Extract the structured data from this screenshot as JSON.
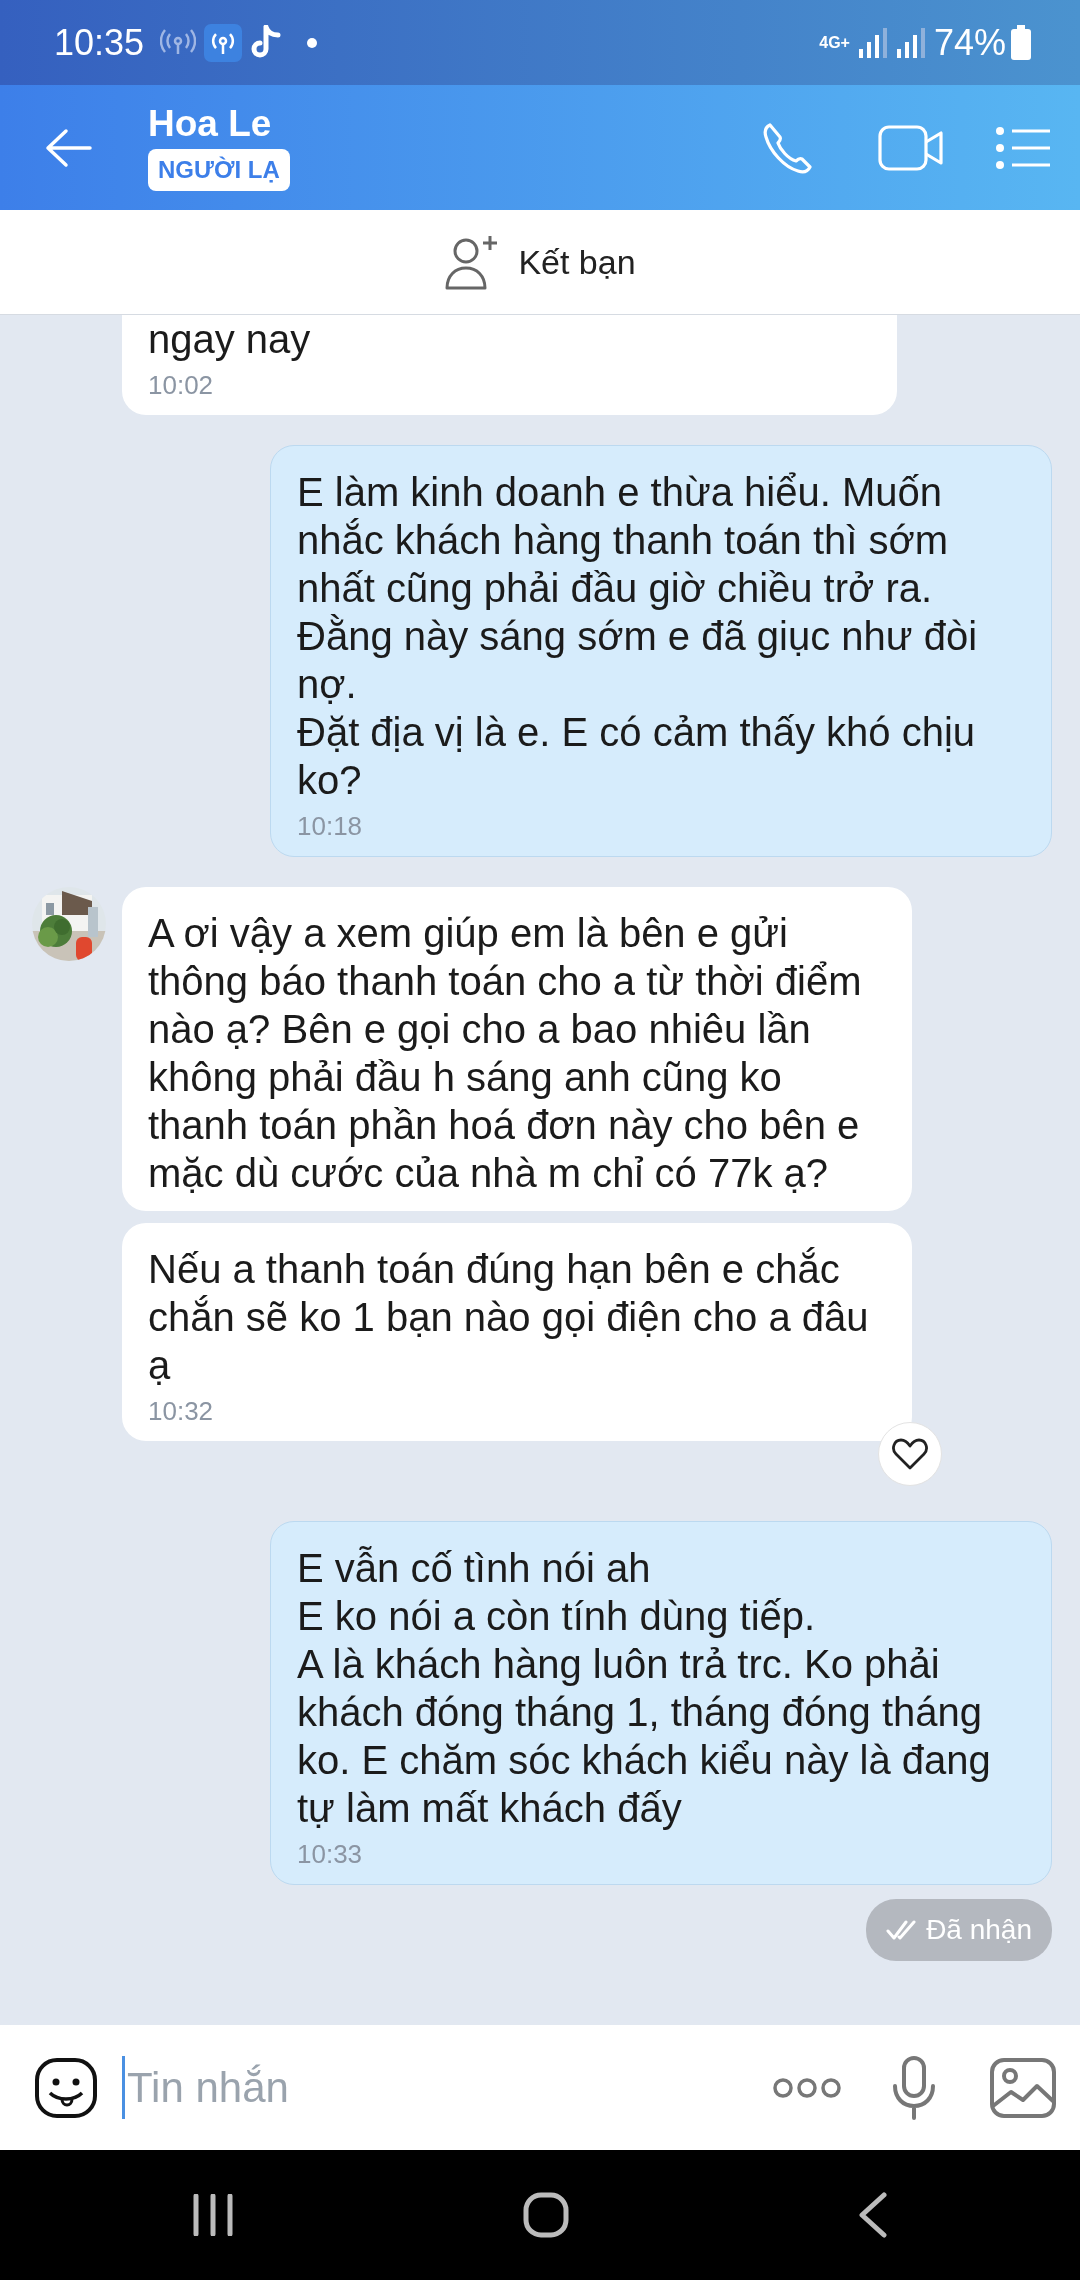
{
  "status_bar": {
    "time": "10:35",
    "network": "4G+",
    "battery": "74%"
  },
  "header": {
    "name": "Hoa Le",
    "badge": "NGƯỜI LẠ"
  },
  "add_friend": {
    "label": "Kết bạn"
  },
  "messages": [
    {
      "kind": "received",
      "avatar": false,
      "text": "ngay nay",
      "time": "10:02",
      "reaction_button": false
    },
    {
      "kind": "sent",
      "avatar": false,
      "text": "E làm kinh doanh e thừa hiểu. Muốn nhắc khách hàng thanh toán thì sớm nhất cũng phải đầu giờ chiều trở ra. Đằng này sáng sớm e đã giục như đòi nợ.\nĐặt địa vị là e. E có cảm thấy khó chịu ko?",
      "time": "10:18",
      "reaction_button": false
    },
    {
      "kind": "received",
      "avatar": true,
      "text": "A ơi vậy a xem giúp em là bên e gửi thông báo thanh toán cho a từ thời điểm nào ạ? Bên e gọi cho a bao nhiêu lần không phải đầu h sáng anh cũng ko thanh toán phần hoá đơn này cho bên e mặc dù cước của nhà m chỉ có 77k ạ?",
      "reaction_button": false
    },
    {
      "kind": "received",
      "avatar": false,
      "text": "Nếu a thanh toán đúng hạn bên e chắc chắn sẽ ko 1 bạn nào gọi điện cho a đâu ạ",
      "time": "10:32",
      "reaction_button": true
    },
    {
      "kind": "sent",
      "avatar": false,
      "text": "E vẫn cố tình nói ah\nE ko nói a còn tính dùng tiếp.\nA là khách hàng luôn trả trc. Ko phải khách đóng tháng 1, tháng đóng tháng ko. E chăm sóc khách kiểu này là đang tự làm mất khách đấy",
      "time": "10:33",
      "reaction_button": false
    }
  ],
  "delivery_status": "Đã nhận",
  "composer": {
    "placeholder": "Tin nhắn"
  }
}
